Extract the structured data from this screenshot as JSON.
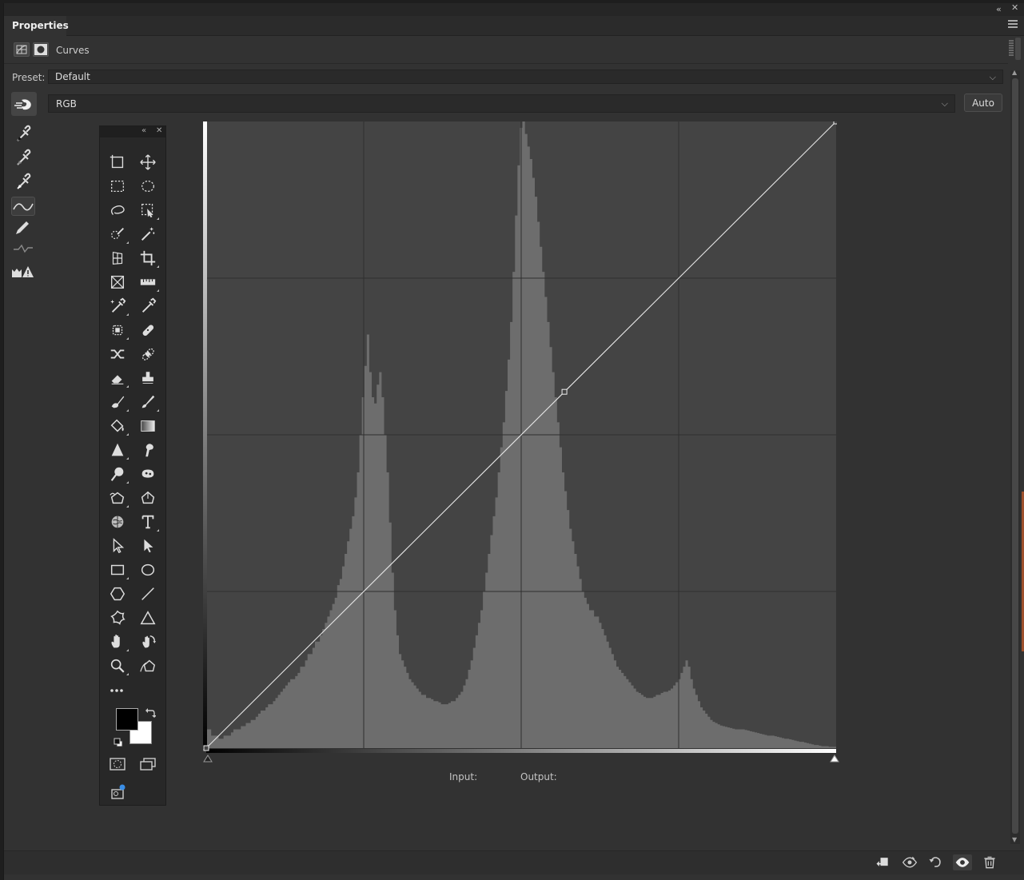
{
  "panel": {
    "tab_label": "Properties",
    "adjustment_name": "Curves"
  },
  "preset": {
    "label": "Preset:",
    "value": "Default"
  },
  "channel": {
    "value": "RGB"
  },
  "auto_label": "Auto",
  "readout": {
    "input_label": "Input:",
    "output_label": "Output:",
    "input_value": "",
    "output_value": ""
  },
  "colors": {
    "panel_bg": "#323232",
    "graph_bg": "#444444",
    "histogram_fill": "#6d6d6d",
    "curve_line": "#e6e6e6",
    "grid": "#2f2f2f"
  },
  "left_tools": [
    {
      "name": "sample-shadows-eyedropper-icon",
      "selected": false
    },
    {
      "name": "sample-midtones-eyedropper-icon",
      "selected": false
    },
    {
      "name": "sample-highlights-eyedropper-icon",
      "selected": false
    },
    {
      "name": "edit-points-curve-icon",
      "selected": true
    },
    {
      "name": "draw-curve-pencil-icon",
      "selected": false
    },
    {
      "name": "smooth-curve-icon",
      "selected": false
    },
    {
      "name": "clipping-warning-icon",
      "selected": false
    }
  ],
  "toolbox_tools": [
    "artboard-icon",
    "move-icon",
    "rect-marquee-icon",
    "ellipse-marquee-icon",
    "lasso-icon",
    "object-selection-icon",
    "quick-selection-icon",
    "magic-wand-icon",
    "perspective-crop-icon",
    "crop-icon",
    "frame-icon",
    "ruler-icon",
    "color-sampler-icon",
    "eyedropper-icon",
    "spot-healing-icon",
    "healing-brush-icon",
    "content-aware-move-icon",
    "patch-icon",
    "eraser-icon",
    "clone-stamp-icon",
    "mixer-brush-icon",
    "brush-icon",
    "paint-bucket-icon",
    "gradient-icon",
    "sharpen-icon",
    "smudge-icon",
    "dodge-icon",
    "sponge-icon",
    "freeform-pen-icon",
    "pen-icon",
    "brain-icon",
    "type-icon",
    "direct-selection-icon",
    "path-selection-icon",
    "rectangle-icon",
    "ellipse-icon",
    "polygon-icon",
    "line-icon",
    "custom-shape-icon",
    "triangle-icon",
    "hand-icon",
    "rotate-view-icon",
    "zoom-icon",
    "curvature-pen-icon"
  ],
  "curve": {
    "points": [
      [
        0,
        0
      ],
      [
        145,
        145
      ],
      [
        255,
        255
      ]
    ]
  },
  "histogram": [
    3,
    3,
    2,
    2,
    2,
    1.5,
    1.5,
    2,
    2,
    2,
    2.5,
    3,
    3,
    3,
    3.5,
    3.5,
    4,
    4,
    4.5,
    4.5,
    5,
    5.5,
    6,
    6,
    6.5,
    7,
    7,
    7.5,
    8,
    8.5,
    9,
    9.5,
    10,
    10.5,
    11,
    11,
    11.5,
    12,
    13,
    13,
    14,
    15,
    15,
    16,
    17,
    17,
    18,
    19,
    20,
    21,
    22,
    23,
    24,
    26,
    27,
    29,
    31,
    33,
    35,
    37,
    40,
    44,
    50,
    56,
    61,
    66,
    60,
    56,
    55,
    58,
    60,
    56,
    50,
    44,
    36,
    28,
    22,
    18,
    15,
    14,
    13,
    12,
    11,
    10.5,
    10,
    9.5,
    9,
    8.5,
    8.5,
    8,
    8,
    7.8,
    7.5,
    7.5,
    7.3,
    7,
    7,
    7,
    7.2,
    7.5,
    7.5,
    8,
    8.5,
    9,
    10,
    11,
    12.5,
    14,
    16,
    18,
    20,
    22,
    25,
    28,
    31,
    34,
    37,
    40,
    44,
    48,
    52,
    57,
    62,
    68,
    76,
    85,
    93,
    99,
    100,
    98,
    96,
    94,
    91,
    88,
    84,
    80,
    76,
    72,
    68,
    64,
    60,
    56,
    52,
    48,
    44,
    41,
    38,
    35,
    33,
    31,
    29,
    27,
    25,
    24,
    23,
    22,
    22,
    21,
    21,
    20,
    19,
    18,
    17,
    16,
    15,
    14,
    13,
    12.5,
    12,
    11.5,
    11,
    10.5,
    10,
    9.5,
    9,
    8.8,
    8.5,
    8.2,
    8,
    8,
    8,
    8.2,
    8.5,
    8.5,
    8.8,
    9,
    9,
    9.2,
    9.5,
    10,
    10.5,
    11,
    12,
    13,
    14,
    13,
    11,
    9.5,
    8.5,
    7.5,
    6.5,
    6,
    5.5,
    5,
    4.5,
    4.2,
    4,
    3.8,
    3.6,
    3.5,
    3.4,
    3.3,
    3.2,
    3.1,
    3,
    3,
    3,
    3,
    2.9,
    2.8,
    2.7,
    2.6,
    2.5,
    2.4,
    2.3,
    2.2,
    2.1,
    2,
    2,
    2,
    1.9,
    1.8,
    1.7,
    1.6,
    1.5,
    1.5,
    1.4,
    1.3,
    1.2,
    1.1,
    1,
    1,
    0.9,
    0.8,
    0.7,
    0.6,
    0.5,
    0.5,
    0.4,
    0.3,
    0.3,
    0.3,
    0.2,
    0.2,
    0.2
  ],
  "footer_buttons": [
    {
      "name": "clip-to-layer-icon",
      "selected": false
    },
    {
      "name": "view-previous-state-icon",
      "selected": false
    },
    {
      "name": "reset-adjustment-icon",
      "selected": false
    },
    {
      "name": "toggle-visibility-icon",
      "selected": true
    },
    {
      "name": "delete-adjustment-icon",
      "selected": false
    }
  ]
}
